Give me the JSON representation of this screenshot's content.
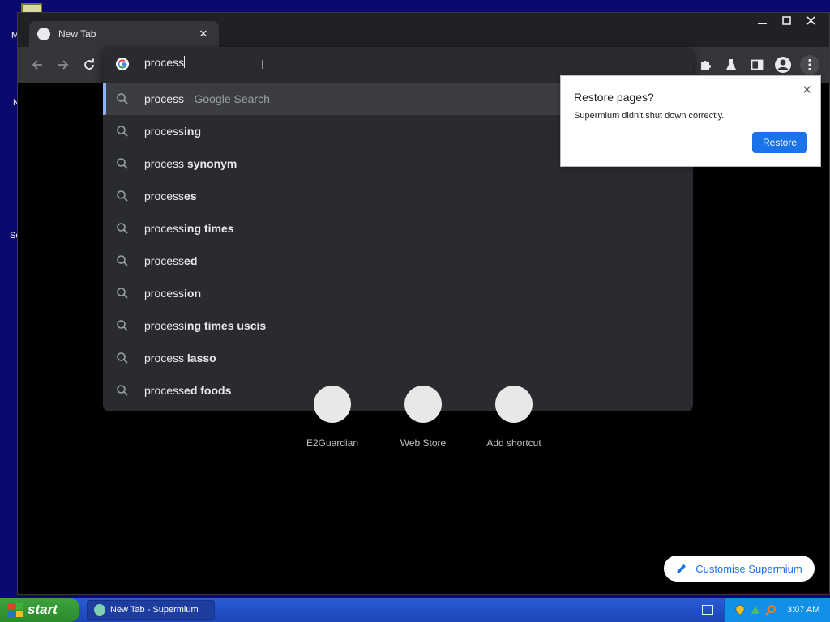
{
  "browser": {
    "tab_title": "New Tab",
    "omnibox_text": "process",
    "suggestions": [
      {
        "prefix": "process",
        "bold": "",
        "suffix": " - Google Search",
        "selected": true
      },
      {
        "prefix": "process",
        "bold": "ing",
        "suffix": "",
        "selected": false
      },
      {
        "prefix": "process",
        "bold": " synonym",
        "suffix": "",
        "selected": false
      },
      {
        "prefix": "process",
        "bold": "es",
        "suffix": "",
        "selected": false
      },
      {
        "prefix": "process",
        "bold": "ing times",
        "suffix": "",
        "selected": false
      },
      {
        "prefix": "process",
        "bold": "ed",
        "suffix": "",
        "selected": false
      },
      {
        "prefix": "process",
        "bold": "ion",
        "suffix": "",
        "selected": false
      },
      {
        "prefix": "process",
        "bold": "ing times uscis",
        "suffix": "",
        "selected": false
      },
      {
        "prefix": "process",
        "bold": " lasso",
        "suffix": "",
        "selected": false
      },
      {
        "prefix": "process",
        "bold": "ed foods",
        "suffix": "",
        "selected": false
      }
    ]
  },
  "restore_bubble": {
    "title": "Restore pages?",
    "message": "Supermium didn't shut down correctly.",
    "button": "Restore"
  },
  "ntp": {
    "shortcuts": [
      "E2Guardian",
      "Web Store",
      "Add shortcut"
    ],
    "customise_label": "Customise Supermium"
  },
  "taskbar": {
    "start_label": "start",
    "task_item": "New Tab - Supermium",
    "clock": "3:07 AM"
  },
  "desktop": {
    "fragments": [
      "M",
      "N",
      "Sc"
    ]
  },
  "colors": {
    "accent": "#1a73e8",
    "suggestion_indicator": "#8ab4f8",
    "taskbar": "#245edb",
    "start_green": "#3ea33e"
  }
}
